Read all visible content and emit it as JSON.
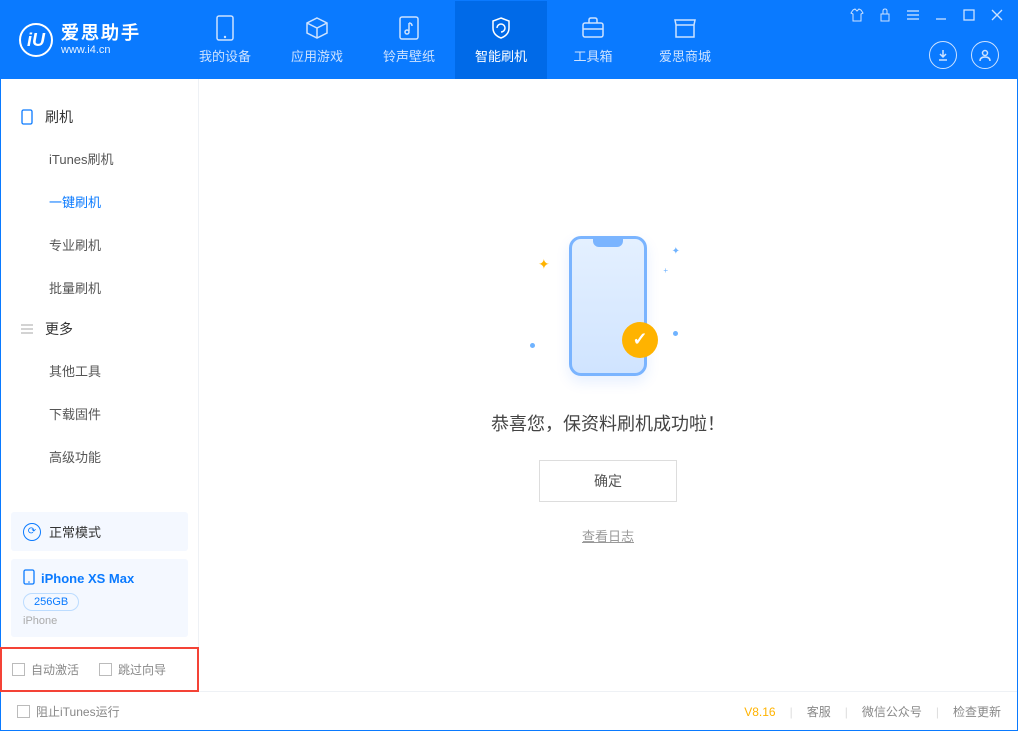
{
  "logo": {
    "glyph": "iU",
    "title": "爱思助手",
    "sub": "www.i4.cn"
  },
  "tabs": {
    "device": "我的设备",
    "apps": "应用游戏",
    "ring": "铃声壁纸",
    "flash": "智能刷机",
    "tools": "工具箱",
    "shop": "爱思商城"
  },
  "sidebar": {
    "group1": "刷机",
    "items1": {
      "itunes": "iTunes刷机",
      "oneclick": "一键刷机",
      "pro": "专业刷机",
      "batch": "批量刷机"
    },
    "group2": "更多",
    "items2": {
      "other": "其他工具",
      "firmware": "下载固件",
      "advanced": "高级功能"
    }
  },
  "mode": {
    "label": "正常模式"
  },
  "device": {
    "name": "iPhone XS Max",
    "capacity": "256GB",
    "type": "iPhone"
  },
  "checks": {
    "autoActivate": "自动激活",
    "skipGuide": "跳过向导"
  },
  "main": {
    "successText": "恭喜您，保资料刷机成功啦！",
    "okBtn": "确定",
    "logLink": "查看日志"
  },
  "footer": {
    "blockItunes": "阻止iTunes运行",
    "version": "V8.16",
    "support": "客服",
    "wechat": "微信公众号",
    "update": "检查更新"
  }
}
